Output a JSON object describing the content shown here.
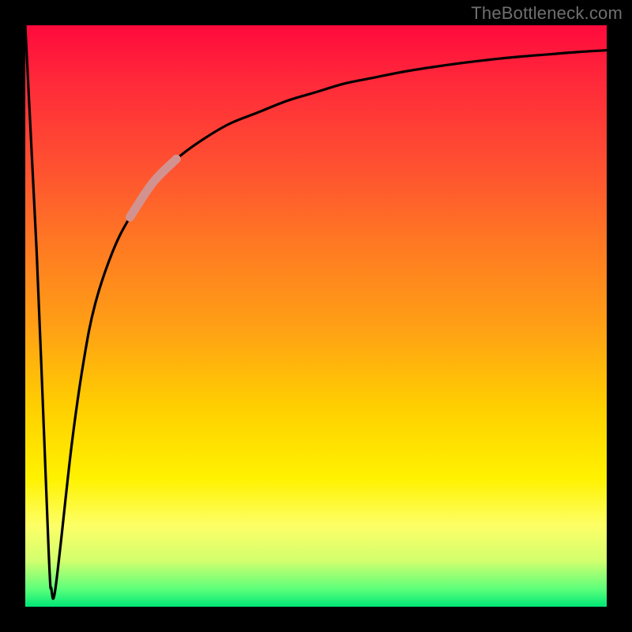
{
  "watermark": "TheBottleneck.com",
  "colors": {
    "frame": "#000000",
    "curve_stroke": "#000000",
    "highlight_stroke": "#d29390",
    "gradient_top": "#ff0a3c",
    "gradient_bottom": "#00e676",
    "watermark_text": "#6f6f6f"
  },
  "chart_data": {
    "type": "line",
    "title": "",
    "xlabel": "",
    "ylabel": "",
    "xlim": [
      0,
      100
    ],
    "ylim": [
      0,
      100
    ],
    "grid": false,
    "legend": false,
    "series": [
      {
        "name": "bottleneck-curve",
        "x": [
          0,
          2,
          4,
          4.5,
          5,
          6,
          8,
          10,
          12,
          15,
          18,
          22,
          26,
          30,
          35,
          40,
          45,
          50,
          55,
          60,
          65,
          70,
          75,
          80,
          85,
          90,
          95,
          100
        ],
        "values": [
          100,
          60,
          10,
          3,
          2,
          10,
          28,
          42,
          52,
          61,
          67,
          73,
          77,
          80,
          83,
          85,
          87,
          88.5,
          90,
          91,
          92,
          92.8,
          93.5,
          94.1,
          94.6,
          95,
          95.4,
          95.7
        ]
      }
    ],
    "highlight_segment": {
      "series": "bottleneck-curve",
      "x_start": 18,
      "x_end": 26
    },
    "annotations": []
  }
}
